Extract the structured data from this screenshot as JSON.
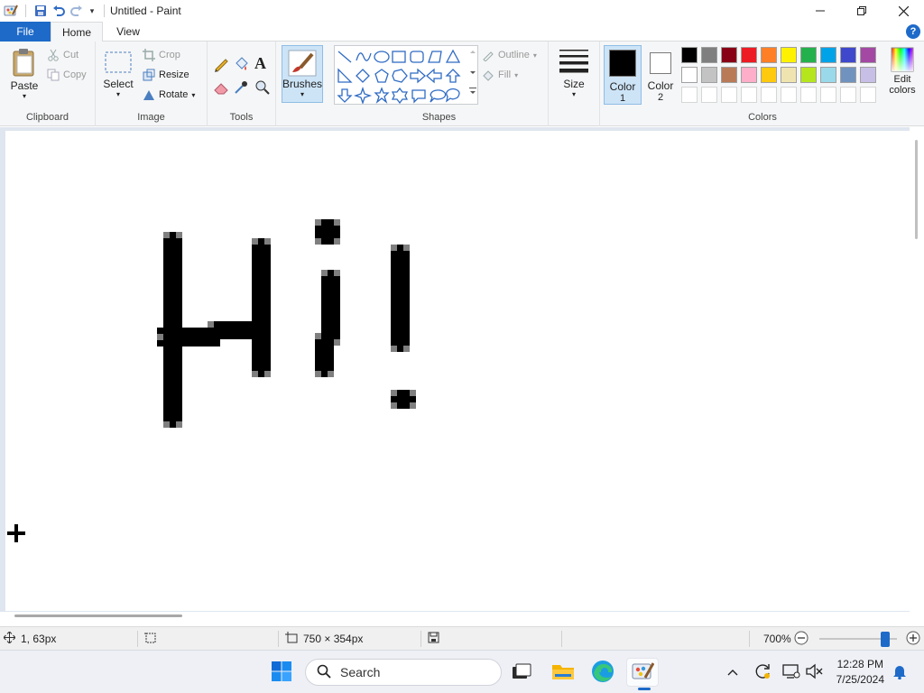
{
  "window": {
    "title": "Untitled - Paint",
    "buttons": [
      "minimize-icon",
      "restore-icon",
      "close-icon"
    ]
  },
  "quick_access": [
    "paint-app-icon",
    "save-icon",
    "undo-icon",
    "redo-icon",
    "customize-dropdown-icon"
  ],
  "tabs": {
    "file": "File",
    "home": "Home",
    "view": "View",
    "active": "Home"
  },
  "ribbon": {
    "clipboard": {
      "label": "Clipboard",
      "paste": "Paste",
      "cut": "Cut",
      "copy": "Copy"
    },
    "image": {
      "label": "Image",
      "select": "Select",
      "crop": "Crop",
      "resize": "Resize",
      "rotate": "Rotate"
    },
    "tools": {
      "label": "Tools"
    },
    "brushes": {
      "label": "Brushes"
    },
    "shapes": {
      "label": "Shapes",
      "outline": "Outline",
      "fill": "Fill"
    },
    "size": {
      "label": "Size"
    },
    "color1": {
      "line1": "Color",
      "line2": "1",
      "value": "#000000"
    },
    "color2": {
      "line1": "Color",
      "line2": "2",
      "value": "#ffffff"
    },
    "colors": {
      "label": "Colors",
      "edit_line1": "Edit",
      "edit_line2": "colors",
      "row1": [
        "#000000",
        "#7f7f7f",
        "#880015",
        "#ed1c24",
        "#ff7f27",
        "#fff200",
        "#22b14c",
        "#00a2e8",
        "#3f48cc",
        "#a349a4"
      ],
      "row2": [
        "#ffffff",
        "#c3c3c3",
        "#b97a57",
        "#ffaec9",
        "#ffc90e",
        "#efe4b0",
        "#b5e61d",
        "#99d9ea",
        "#7092be",
        "#c8bfe7"
      ],
      "row3": [
        "#ffffff",
        "#ffffff",
        "#ffffff",
        "#ffffff",
        "#ffffff",
        "#ffffff",
        "#ffffff",
        "#ffffff",
        "#ffffff",
        "#ffffff"
      ]
    }
  },
  "canvas": {
    "drawing_text": "Hi!"
  },
  "status": {
    "cursor_position": "1, 63px",
    "canvas_size": "750 × 354px",
    "zoom": "700%"
  },
  "taskbar": {
    "search_placeholder": "Search",
    "time": "12:28 PM",
    "date": "7/25/2024"
  }
}
